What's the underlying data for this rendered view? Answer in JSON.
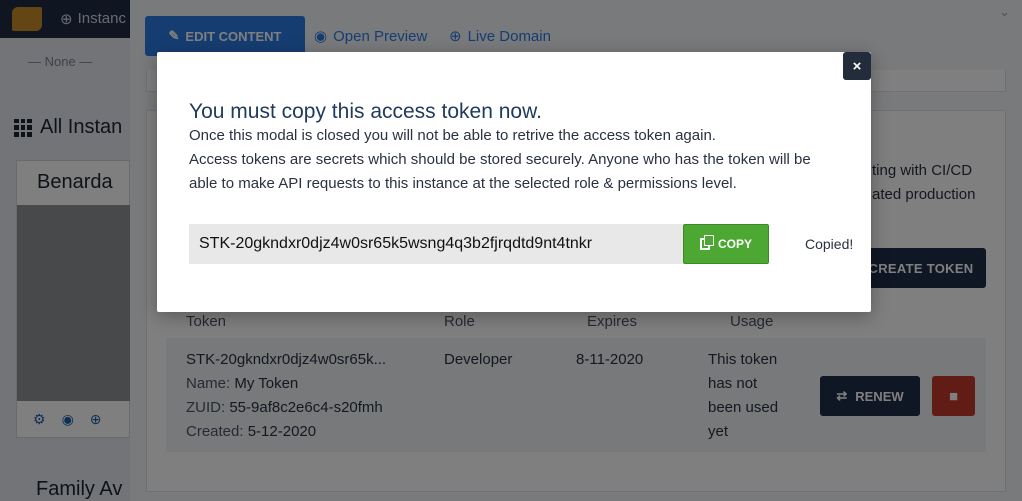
{
  "app": {
    "top_nav_label": "Instanc",
    "filter_value": "— None —",
    "all_instances_label": "All Instan",
    "instance_card_title": "Benarda",
    "family_title": "Family Av"
  },
  "tabs": {
    "edit_content": "EDIT CONTENT",
    "open_preview": "Open Preview",
    "live_domain": "Live Domain"
  },
  "section_text": {
    "line1": "ting with CI/CD",
    "line2": "ated production"
  },
  "create_token_label": "CREATE TOKEN",
  "table": {
    "headers": [
      "Token",
      "Role",
      "Expires",
      "Usage"
    ],
    "row": {
      "token": "STK-20gkndxr0djz4w0sr65k...",
      "name_label": "Name:",
      "name_value": "My Token",
      "zuid_label": "ZUID:",
      "zuid_value": "55-9af8c2e6c4-s20fmh",
      "created_label": "Created:",
      "created_value": "5-12-2020",
      "role": "Developer",
      "expires": "8-11-2020",
      "usage": [
        "This token",
        "has not",
        "been used",
        "yet"
      ],
      "renew_label": "RENEW"
    }
  },
  "modal": {
    "close_symbol": "×",
    "title": "You must copy this access token now.",
    "line1": "Once this modal is closed you will not be able to retrive the access token again.",
    "line2": "Access tokens are secrets which should be stored securely. Anyone who has the token will be able to make API requests to this instance at the selected role & permissions level.",
    "token_value": "STK-20gkndxr0djz4w0sr65k5wsng4q3b2fjrqdtd9nt4tnkr",
    "copy_label": "COPY",
    "copied_label": "Copied!"
  },
  "colors": {
    "primary_blue": "#2c7be5",
    "copy_green": "#4ca833",
    "delete_red": "#c0392b",
    "dark_navy": "#1f2f48"
  }
}
